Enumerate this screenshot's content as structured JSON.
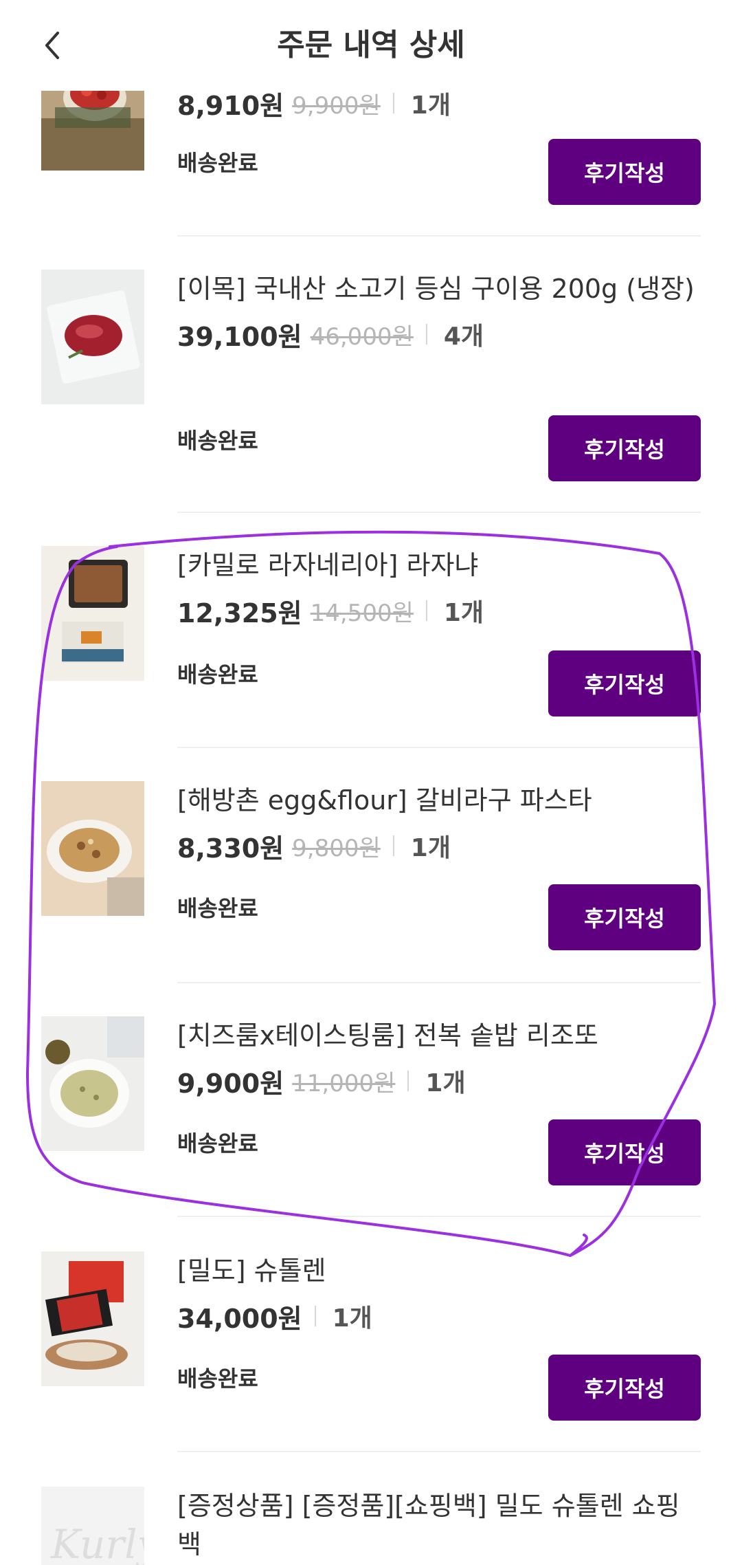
{
  "header": {
    "title": "주문 내역 상세"
  },
  "items": [
    {
      "name": "",
      "price": "8,910원",
      "original": "9,900원",
      "qty": "1개",
      "status": "배송완료",
      "button": "후기작성"
    },
    {
      "name": "[이목] 국내산 소고기 등심 구이용 200g (냉장)",
      "price": "39,100원",
      "original": "46,000원",
      "qty": "4개",
      "status": "배송완료",
      "button": "후기작성"
    },
    {
      "name": "[카밀로 라자네리아] 라자냐",
      "price": "12,325원",
      "original": "14,500원",
      "qty": "1개",
      "status": "배송완료",
      "button": "후기작성"
    },
    {
      "name": "[해방촌 egg&flour] 갈비라구 파스타",
      "price": "8,330원",
      "original": "9,800원",
      "qty": "1개",
      "status": "배송완료",
      "button": "후기작성"
    },
    {
      "name": "[치즈룸x테이스팅룸] 전복 솥밥 리조또",
      "price": "9,900원",
      "original": "11,000원",
      "qty": "1개",
      "status": "배송완료",
      "button": "후기작성"
    },
    {
      "name": "[밀도] 슈톨렌",
      "price": "34,000원",
      "original": "",
      "qty": "1개",
      "status": "배송완료",
      "button": "후기작성"
    },
    {
      "name": "[증정상품] [증정품][쇼핑백] 밀도 슈톨렌 쇼핑백"
    }
  ],
  "thumb_logo": "Kurly",
  "colors": {
    "accent": "#5f0080",
    "annotation": "#9b30e0"
  }
}
